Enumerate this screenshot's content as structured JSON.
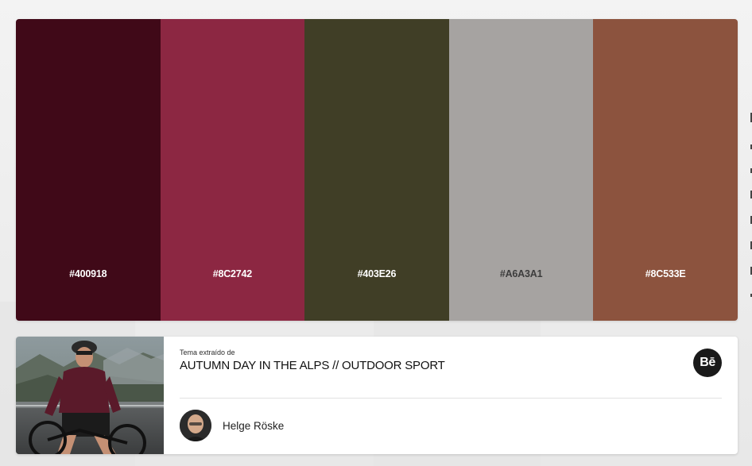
{
  "palette": {
    "swatches": [
      {
        "hex": "#400918",
        "color": "#400918",
        "text_color": "#ffffff"
      },
      {
        "hex": "#8C2742",
        "color": "#8C2742",
        "text_color": "#ffffff"
      },
      {
        "hex": "#403E26",
        "color": "#403E26",
        "text_color": "#ffffff"
      },
      {
        "hex": "#A6A3A1",
        "color": "#A6A3A1",
        "text_color": "#3d3d3d"
      },
      {
        "hex": "#8C533E",
        "color": "#8C533E",
        "text_color": "#ffffff"
      }
    ]
  },
  "source": {
    "caption": "Tema extraído de",
    "title": "AUTUMN DAY IN THE ALPS // OUTDOOR SPORT",
    "behance_label": "Bē",
    "author": "Helge Röske"
  },
  "icons": {
    "behance": "behance-icon",
    "avatar": "author-avatar"
  }
}
